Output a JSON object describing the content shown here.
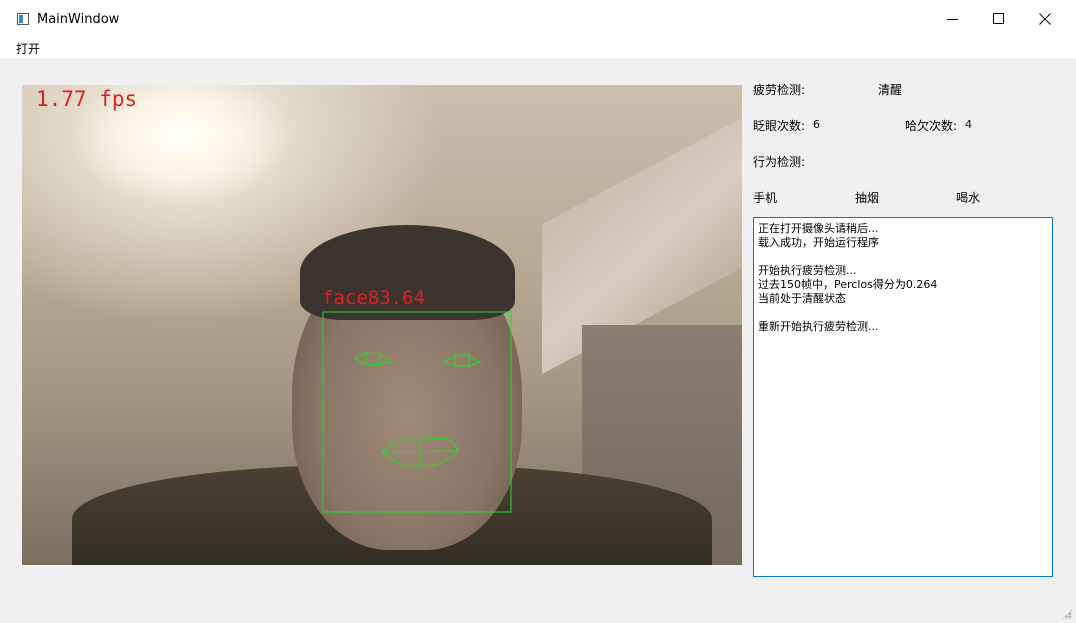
{
  "window": {
    "title": "MainWindow"
  },
  "menu": {
    "open": "打开"
  },
  "video": {
    "fps_text": "1.77 fps",
    "face_text": "face83.64"
  },
  "panel": {
    "fatigue_label": "疲劳检测:",
    "fatigue_status": "清醒",
    "blink_label": "眨眼次数:",
    "blink_count": "6",
    "yawn_label": "哈欠次数:",
    "yawn_count": "4",
    "behavior_label": "行为检测:",
    "phone": "手机",
    "smoking": "抽烟",
    "drinking": "喝水"
  },
  "log": {
    "text": "正在打开摄像头请稍后...\n载入成功，开始运行程序\n\n开始执行疲劳检测...\n过去150帧中，Perclos得分为0.264\n当前处于清醒状态\n\n重新开始执行疲劳检测..."
  },
  "colors": {
    "overlay_text": "#e02020",
    "landmark_lines": "#22dd22",
    "log_border": "#0078d7"
  }
}
